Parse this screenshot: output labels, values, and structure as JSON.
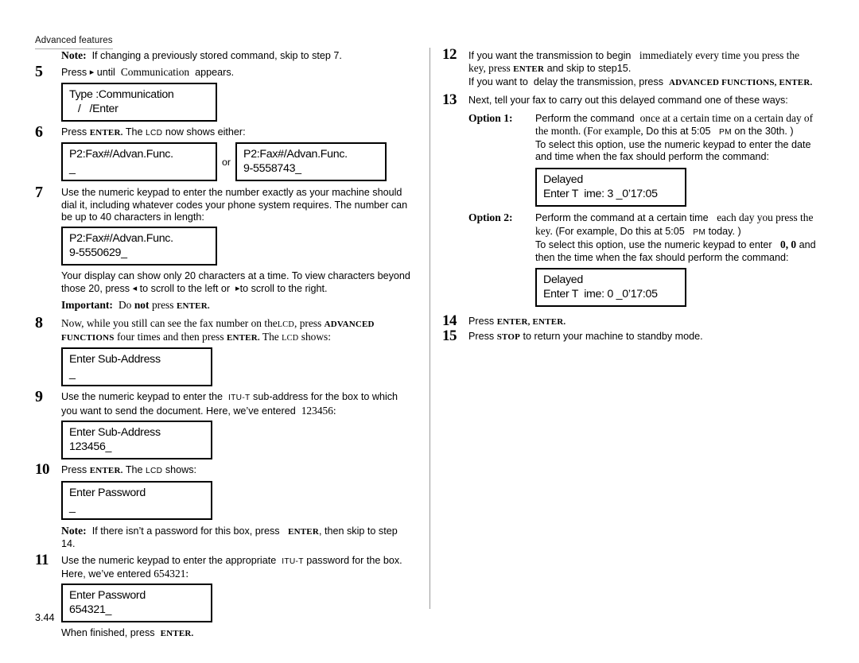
{
  "header": {
    "running_head": "Advanced features"
  },
  "folio": {
    "page_number": "3.44"
  },
  "left_column": {
    "note_top": {
      "label": "Note:",
      "text": "If changing a previously stored command, skip to step 7."
    },
    "step5": {
      "number": "5",
      "text_before": "Press",
      "arrow": "▸",
      "text_mid": "until",
      "emphasis": "Communication",
      "text_after": "appears."
    },
    "lcd_step5": {
      "line1": "Type :Communication",
      "line2": "   /   /Enter"
    },
    "step6": {
      "number": "6",
      "text_a": "Press",
      "key": "ENTER.",
      "text_b": "The",
      "lcd_word": "LCD",
      "text_c": "now shows either:"
    },
    "lcd_step6_a": {
      "line1": "P2:Fax#/Advan.Func.",
      "line2": "_"
    },
    "or_label": "or",
    "lcd_step6_b": {
      "line1": "P2:Fax#/Advan.Func.",
      "line2": "9-5558743_"
    },
    "step7": {
      "number": "7",
      "text": "Use the numeric keypad to enter the number    exactly as your machine should dial it, including whatever codes your phone system requires. The number can be up to 40 characters in length:"
    },
    "lcd_step7": {
      "line1": "P2:Fax#/Advan.Func.",
      "line2": "9-5550629_"
    },
    "scroll_note": {
      "line1": "Your display can show only 20 characters at a time. To view characters beyond",
      "part_a": "those 20, press",
      "left_arrow": "◂",
      "part_b": "to scroll to the left or",
      "right_arrow": "▸",
      "part_c": "to scroll to the right."
    },
    "important": {
      "label": "Important:",
      "text_a": "Do",
      "text_not": "not",
      "text_b": "press",
      "key": "ENTER."
    },
    "step8": {
      "number": "8",
      "text_a": "Now, while you still can see the fax number on the",
      "lcd_word": "LCD",
      "text_b": ", press",
      "key1": "ADVANCED FUNCTIONS",
      "text_c": "four times and then press",
      "key2": "ENTER.",
      "text_d": "The",
      "lcd_word2": "LCD",
      "text_e": "shows:"
    },
    "lcd_step8": {
      "line1": "Enter Sub-Address",
      "line2": "_"
    },
    "step9": {
      "number": "9",
      "text_a": "Use the numeric keypad to enter the",
      "itu": "ITU-T",
      "text_b": "sub-address for the box to which you want to send the document. Here, we’ve entered",
      "value": "123456:"
    },
    "lcd_step9": {
      "line1": "Enter Sub-Address",
      "line2": "123456_"
    },
    "step10": {
      "number": "10",
      "text_a": "Press",
      "key": "ENTER.",
      "text_b": "The",
      "lcd_word": "LCD",
      "text_c": "shows:"
    },
    "lcd_step10": {
      "line1": "Enter Password",
      "line2": "_"
    },
    "note_password": {
      "label": "Note:",
      "text_a": "If there isn’t a password for this box, press",
      "key": "ENTER",
      "text_b": ", then skip to step 14."
    },
    "step11": {
      "number": "11",
      "text_a": "Use the numeric keypad to enter the appropriate",
      "itu": "ITU-T",
      "text_b": "password for the box. Here, we’ve entered",
      "value": "654321:"
    },
    "lcd_step11": {
      "line1": "Enter Password",
      "line2": "654321_"
    },
    "finish_note": {
      "text_a": "When finished, press",
      "key": "ENTER."
    }
  },
  "right_column": {
    "step12": {
      "number": "12",
      "line1_a": "If you want the transmission to begin",
      "line1_b": "immediately every time you press the key, press",
      "key1": "ENTER",
      "line1_c": "and skip to step15.",
      "line2_a": "If you want to",
      "line2_b": "delay the transmission, press",
      "key2": "ADVANCED FUNCTIONS, ENTER."
    },
    "step13": {
      "number": "13",
      "text": "Next, tell your fax to carry out this delayed command one of these ways:"
    },
    "option1": {
      "label": "Option 1:",
      "line1_a": "Perform the command",
      "line1_b": "once at a certain time on a certain day of the month. (For example,",
      "example": "Do this at 5:05",
      "pm": "PM",
      "example_end": "on the 30th.",
      "paren": ")",
      "line3": "To select this option, use the numeric keypad to enter the date and time when the fax should perform the command:"
    },
    "lcd_option1": {
      "line1": "Delayed",
      "line2": "Enter T  ime: 3 _0’17:05"
    },
    "option2": {
      "label": "Option 2:",
      "line1_a": "Perform the command at a certain time",
      "line1_b": "each day you press the key.",
      "example_lead": "(For example,",
      "example": "Do this at 5:05",
      "pm": "PM",
      "example_end": "today.",
      "paren": ")",
      "line3_a": "To select this option, use the numeric keypad to enter",
      "value": "0, 0",
      "line3_b": "and then the time when the fax should perform the command:"
    },
    "lcd_option2": {
      "line1": "Delayed",
      "line2": "Enter T  ime: 0 _0’17:05"
    },
    "step14": {
      "number": "14",
      "text_a": "Press",
      "key": "ENTER, ENTER."
    },
    "step15": {
      "number": "15",
      "text_a": "Press",
      "key": "STOP",
      "text_b": "to return your machine to standby mode."
    }
  }
}
